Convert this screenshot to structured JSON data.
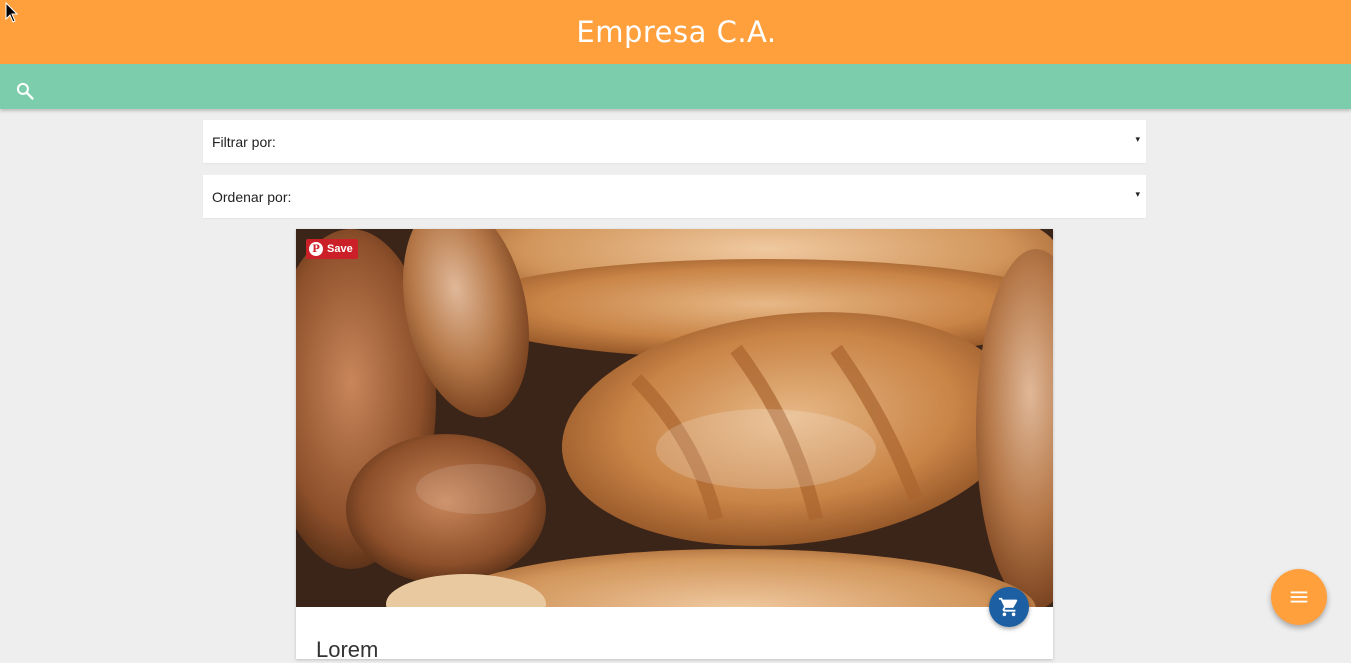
{
  "header": {
    "title": "Empresa C.A.",
    "color": "#ffa03d"
  },
  "search": {
    "icon": "search-icon",
    "bar_color": "#7bcdab"
  },
  "filters": {
    "filter_label": "Filtrar por:",
    "order_label": "Ordenar por:",
    "arrow": "▾"
  },
  "product": {
    "image_desc": "bread-loaves-photo",
    "pin_save_label": "Save",
    "pin_logo": "P",
    "cart_icon": "cart-icon",
    "title": "Lorem"
  },
  "fab": {
    "icon": "menu-icon",
    "color": "#ffa03d"
  },
  "colors": {
    "pinterest_red": "#cb2027",
    "cart_blue": "#1c5fa2"
  }
}
